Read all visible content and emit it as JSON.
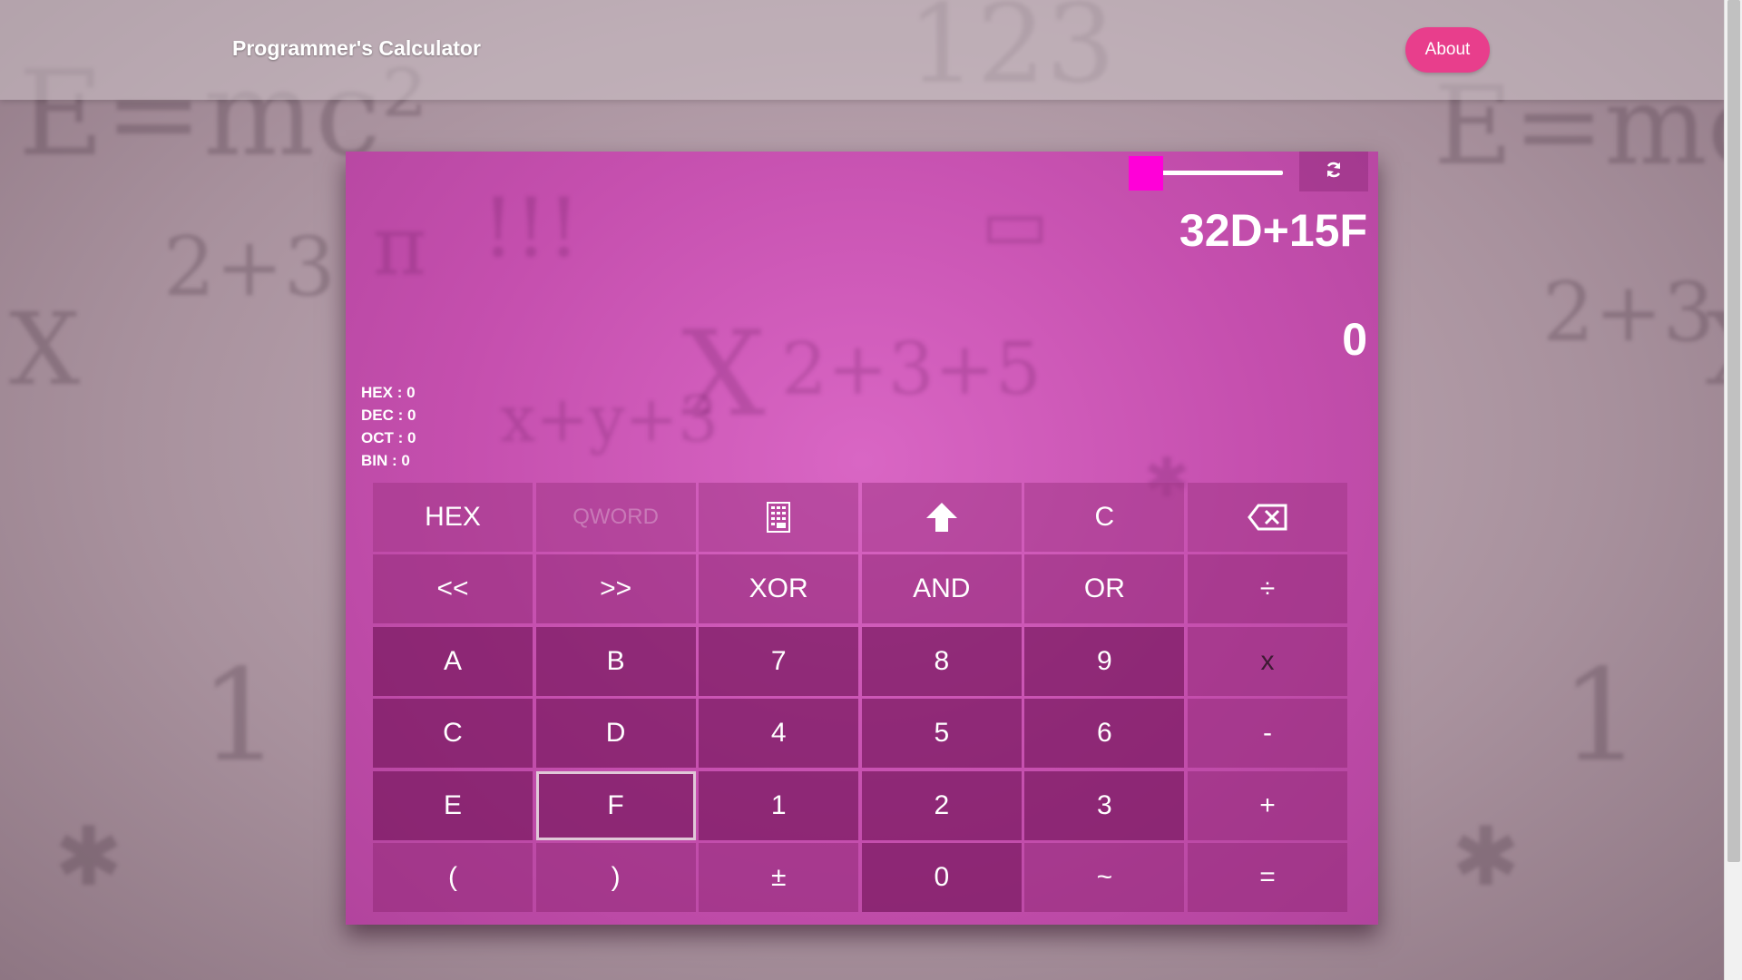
{
  "app": {
    "title": "Programmer's Calculator",
    "about_label": "About"
  },
  "display": {
    "expression": "32D+15F",
    "result": "0",
    "conversions": [
      {
        "label": "HEX",
        "value": "0"
      },
      {
        "label": "DEC",
        "value": "0"
      },
      {
        "label": "OCT",
        "value": "0"
      },
      {
        "label": "BIN",
        "value": "0"
      }
    ]
  },
  "toolbar": {
    "opacity_slider_value": 0,
    "refresh_icon": "refresh-icon",
    "accent_color": "#ff00d8"
  },
  "keypad": {
    "rows": [
      [
        "HEX",
        "QWORD",
        "",
        "",
        "C",
        ""
      ],
      [
        "<<",
        ">>",
        "XOR",
        "AND",
        "OR",
        "÷"
      ],
      [
        "A",
        "B",
        "7",
        "8",
        "9",
        "x"
      ],
      [
        "C",
        "D",
        "4",
        "5",
        "6",
        "-"
      ],
      [
        "E",
        "F",
        "1",
        "2",
        "3",
        "+"
      ],
      [
        "(",
        ")",
        "±",
        "0",
        "~",
        "="
      ]
    ],
    "icons": {
      "keypad_toggle": "calculator-keypad-icon",
      "shift": "arrow-up-icon",
      "backspace": "backspace-icon"
    }
  },
  "colors": {
    "about_button": "#e83e8c",
    "panel": "#c54fae"
  }
}
